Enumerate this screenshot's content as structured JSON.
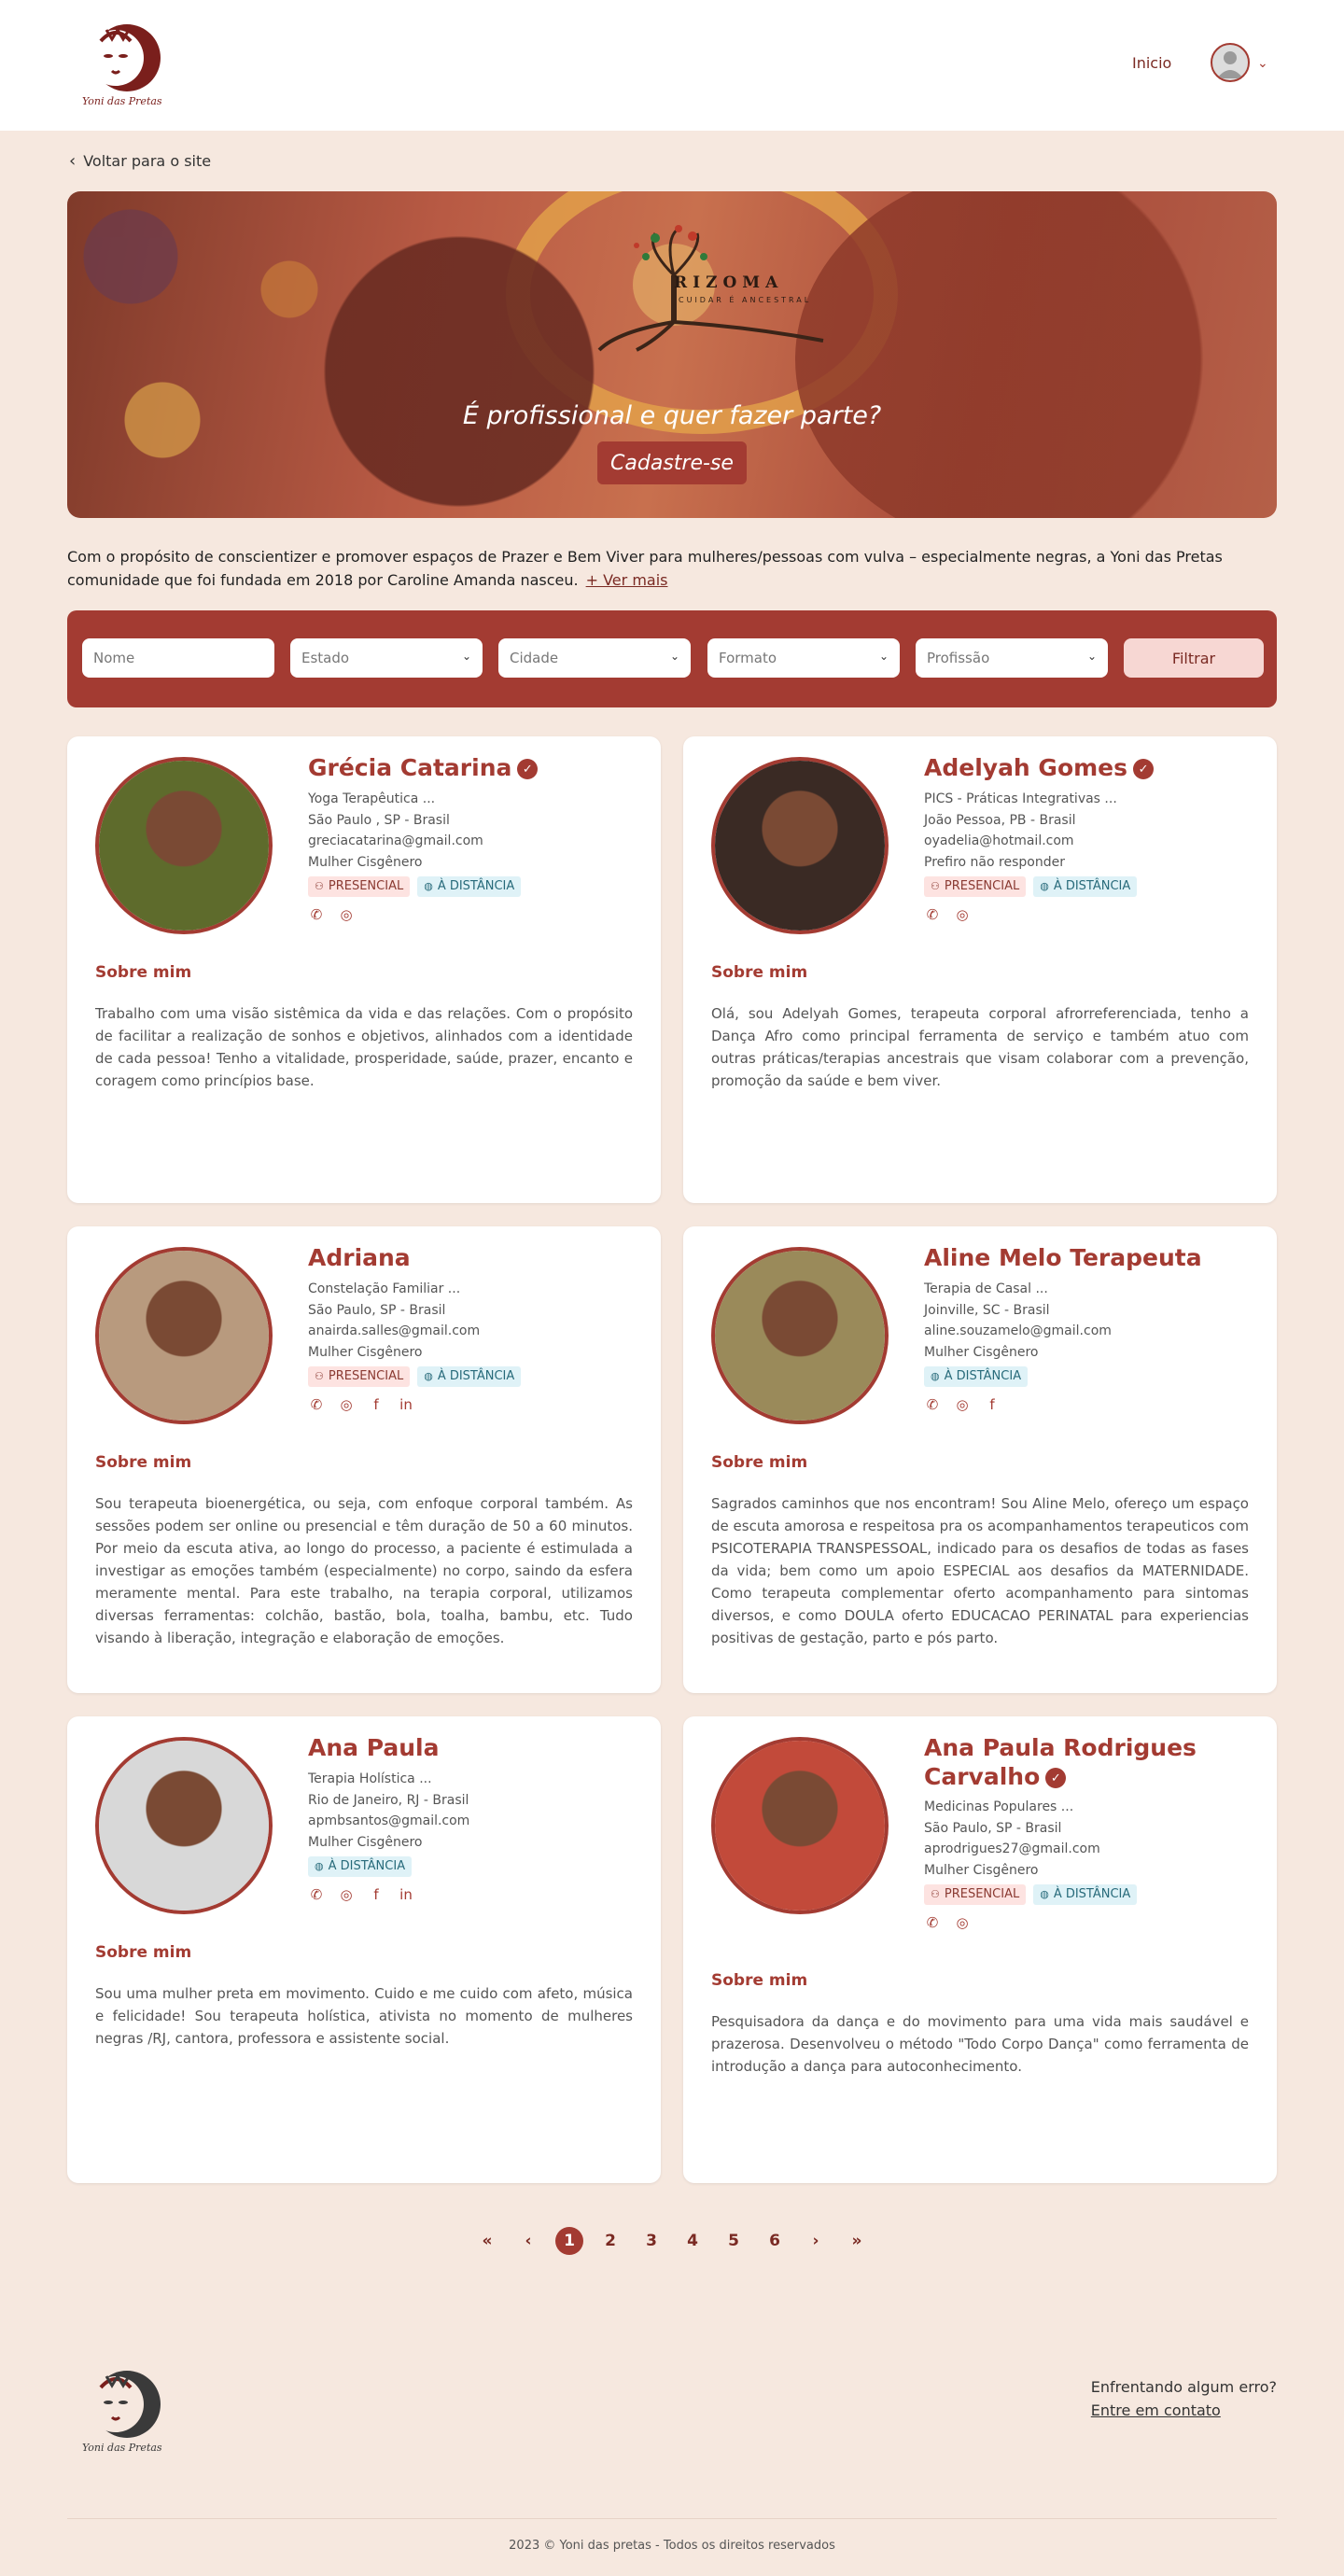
{
  "header": {
    "nav_inicio": "Inicio",
    "logo_alt": "Yoni das Pretas"
  },
  "back_link": "Voltar para o site",
  "banner": {
    "brand": "RIZOMA",
    "brand_sub": "CUIDAR É ANCESTRAL",
    "question": "É profissional e quer fazer parte?",
    "cta": "Cadastre-se"
  },
  "intro": {
    "text": "Com o propósito de conscientizer e promover espaços de Prazer e Bem Viver para mulheres/pessoas com vulva – especialmente negras, a Yoni das Pretas comunidade que foi fundada em 2018 por Caroline Amanda nasceu.",
    "more": "+ Ver mais"
  },
  "filters": {
    "nome_placeholder": "Nome",
    "estado": "Estado",
    "cidade": "Cidade",
    "formato": "Formato",
    "profissao": "Profissão",
    "button": "Filtrar"
  },
  "tags": {
    "presencial": "PRESENCIAL",
    "distancia": "À DISTÂNCIA"
  },
  "about_title": "Sobre mim",
  "cards": [
    {
      "name": "Grécia Catarina",
      "verified": true,
      "specialty": "Yoga Terapêutica ...",
      "location": "São Paulo , SP - Brasil",
      "email": "greciacatarina@gmail.com",
      "gender": "Mulher Cisgênero",
      "presencial": true,
      "distancia": true,
      "social": [
        "whatsapp-icon",
        "instagram-icon"
      ],
      "about": "Trabalho com uma visão sistêmica da vida e das relações. Com o propósito de facilitar a realização de sonhos e objetivos, alinhados com a identidade de cada pessoa! Tenho a vitalidade, prosperidade, saúde, prazer, encanto e coragem como princípios base.",
      "photo_bg": "#5e6b2c"
    },
    {
      "name": "Adelyah Gomes",
      "verified": true,
      "specialty": "PICS - Práticas Integrativas ...",
      "location": "João Pessoa, PB - Brasil",
      "email": "oyadelia@hotmail.com",
      "gender": "Prefiro não responder",
      "presencial": true,
      "distancia": true,
      "social": [
        "whatsapp-icon",
        "instagram-icon"
      ],
      "about": "Olá, sou Adelyah Gomes, terapeuta corporal afrorreferenciada, tenho a Dança Afro como principal ferramenta de serviço e também atuo com outras práticas/terapias ancestrais que visam colaborar com a prevenção, promoção da saúde e bem viver.",
      "photo_bg": "#3a2a24"
    },
    {
      "name": "Adriana",
      "verified": false,
      "specialty": "Constelação Familiar ...",
      "location": "São Paulo, SP - Brasil",
      "email": "anairda.salles@gmail.com",
      "gender": "Mulher Cisgênero",
      "presencial": true,
      "distancia": true,
      "social": [
        "whatsapp-icon",
        "instagram-icon",
        "facebook-icon",
        "linkedin-icon"
      ],
      "about": "Sou terapeuta bioenergética, ou seja, com enfoque corporal também. As sessões podem ser online ou presencial e têm duração de 50 a 60 minutos. Por meio da escuta ativa, ao longo do processo, a paciente é estimulada a investigar as emoções também (especialmente) no corpo, saindo da esfera meramente mental. Para este trabalho, na terapia corporal, utilizamos diversas ferramentas: colchão, bastão, bola, toalha, bambu, etc. Tudo visando à liberação, integração e elaboração de emoções.",
      "photo_bg": "#b89a7e"
    },
    {
      "name": "Aline Melo Terapeuta",
      "verified": false,
      "specialty": "Terapia de Casal ...",
      "location": "Joinville, SC - Brasil",
      "email": "aline.souzamelo@gmail.com",
      "gender": "Mulher Cisgênero",
      "presencial": false,
      "distancia": true,
      "social": [
        "whatsapp-icon",
        "instagram-icon",
        "facebook-icon"
      ],
      "about": "Sagrados caminhos que nos encontram! Sou Aline Melo, ofereço um espaço de escuta amorosa e respeitosa pra os acompanhamentos terapeuticos com PSICOTERAPIA TRANSPESSOAL, indicado para os desafios de todas as fases da vida; bem como um apoio ESPECIAL aos desafios da MATERNIDADE. Como terapeuta complementar oferto acompanhamento para sintomas diversos, e como DOULA oferto EDUCACAO PERINATAL para experiencias positivas de gestação, parto e pós parto.",
      "photo_bg": "#9a8a5a"
    },
    {
      "name": "Ana Paula",
      "verified": false,
      "specialty": "Terapia Holística ...",
      "location": "Rio de Janeiro, RJ - Brasil",
      "email": "apmbsantos@gmail.com",
      "gender": "Mulher Cisgênero",
      "presencial": false,
      "distancia": true,
      "social": [
        "whatsapp-icon",
        "instagram-icon",
        "facebook-icon",
        "linkedin-icon"
      ],
      "about": "Sou uma mulher preta em movimento. Cuido e me cuido com afeto, música e felicidade! Sou terapeuta holística, ativista no momento de mulheres negras /RJ, cantora, professora e assistente social.",
      "photo_bg": "#d8d8d8"
    },
    {
      "name": "Ana Paula Rodrigues Carvalho",
      "verified": true,
      "specialty": "Medicinas Populares ...",
      "location": "São Paulo, SP - Brasil",
      "email": "aprodrigues27@gmail.com",
      "gender": "Mulher Cisgênero",
      "presencial": true,
      "distancia": true,
      "social": [
        "whatsapp-icon",
        "instagram-icon"
      ],
      "about": "Pesquisadora da dança e do movimento para uma vida mais saudável e prazerosa. Desenvolveu o método \"Todo Corpo Dança\" como ferramenta de introdução a dança para autoconhecimento.",
      "photo_bg": "#c24a3a"
    }
  ],
  "pagination": {
    "first": "«",
    "prev": "‹",
    "next": "›",
    "last": "»",
    "pages": [
      "1",
      "2",
      "3",
      "4",
      "5",
      "6"
    ],
    "current": "1"
  },
  "footer": {
    "error_q": "Enfrentando algum erro?",
    "contact": "Entre em contato",
    "copyright": "2023 © Yoni das pretas - Todos os direitos reservados"
  },
  "colors": {
    "accent": "#a33b32",
    "page_bg": "#f6e8df",
    "filter_btn_bg": "#f7d7d3"
  }
}
